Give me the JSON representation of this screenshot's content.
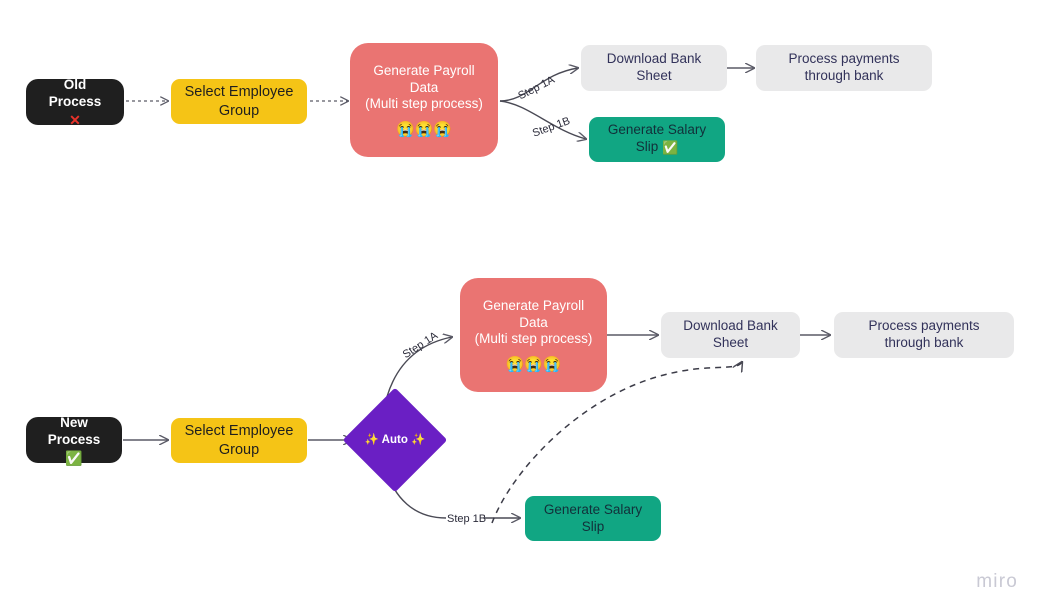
{
  "board": {
    "watermark": "miro",
    "background": "#ffffff"
  },
  "colors": {
    "dark": "#1f1f1f",
    "yellow": "#f5c416",
    "red": "#ea7472",
    "gray": "#e9e9ea",
    "green": "#11a683",
    "purple": "#6a1fc4",
    "edge": "#5a5a66",
    "text_dark": "#32325a",
    "cross_red": "#e8322a"
  },
  "top_flow": {
    "start": {
      "label": "Old Process",
      "mark": "✕",
      "mark_name": "red-cross-mark"
    },
    "select_group": {
      "label": "Select Employee Group"
    },
    "payroll": {
      "line1": "Generate Payroll Data",
      "line2": "(Multi step process)",
      "emojis": "😭😭😭",
      "emoji_name": "crying-face-emoji"
    },
    "download": {
      "label": "Download Bank Sheet"
    },
    "process_payments": {
      "label": "Process payments through bank"
    },
    "salary_slip": {
      "label": "Generate Salary Slip",
      "mark": "✅",
      "mark_name": "green-check-mark"
    },
    "edge_labels": {
      "step_1a": "Step 1A",
      "step_1b": "Step 1B"
    }
  },
  "bottom_flow": {
    "start": {
      "label": "New Process",
      "mark": "✅",
      "mark_name": "green-check-mark"
    },
    "select_group": {
      "label": "Select Employee Group"
    },
    "decision": {
      "label": "✨ Auto ✨"
    },
    "payroll": {
      "line1": "Generate Payroll Data",
      "line2": "(Multi step process)",
      "emojis": "😭😭😭",
      "emoji_name": "crying-face-emoji"
    },
    "download": {
      "label": "Download Bank Sheet"
    },
    "process_payments": {
      "label": "Process payments through bank"
    },
    "salary_slip": {
      "label": "Generate Salary Slip"
    },
    "edge_labels": {
      "step_1a": "Step 1A",
      "step_1b": "Step 1B"
    }
  }
}
